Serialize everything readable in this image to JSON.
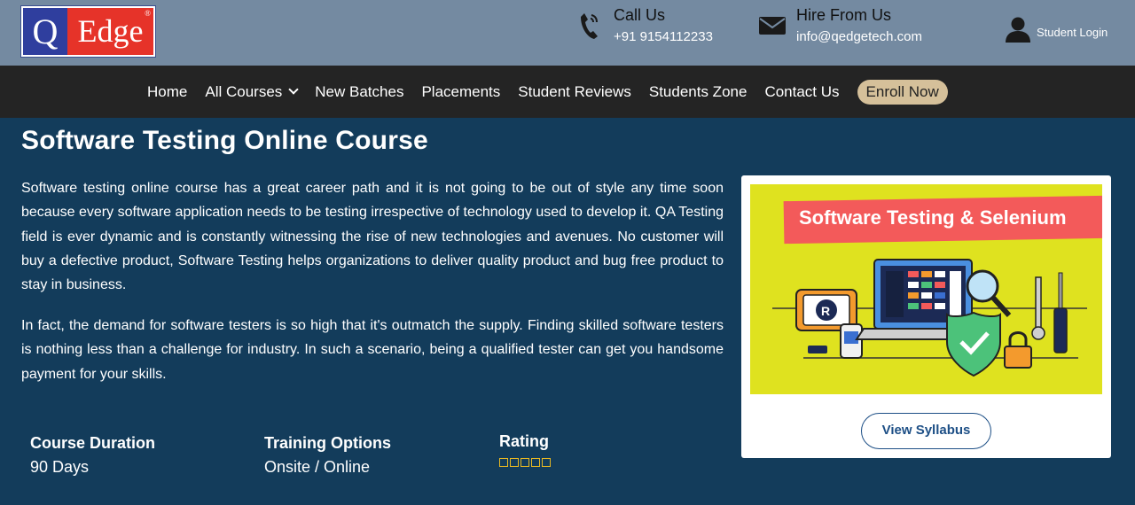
{
  "header": {
    "logo": {
      "left_letter": "Q",
      "right_text": "Edge",
      "reg_mark": "®"
    },
    "call": {
      "title": "Call Us",
      "number": "+91 9154112233",
      "icon": "phone-icon"
    },
    "hire": {
      "title": "Hire From Us",
      "email": "info@qedgetech.com",
      "icon": "envelope-icon"
    },
    "student_login": {
      "label": "Student Login",
      "icon": "user-icon"
    }
  },
  "nav": {
    "items": [
      "Home",
      "All Courses",
      "New Batches",
      "Placements",
      "Student Reviews",
      "Students Zone",
      "Contact Us"
    ],
    "dropdown_icon": "chevron-down-icon",
    "enroll": "Enroll Now"
  },
  "main": {
    "title": "Software Testing Online Course",
    "paragraphs": [
      "Software testing online course has a great career path and it is not going to be out of style any time soon because every software application needs to be testing irrespective of technology used to develop it. QA Testing field is ever dynamic and is constantly witnessing the rise of new technologies and avenues. No customer will buy a defective product, Software Testing helps organizations to deliver quality product and bug free product to stay in business.",
      "In fact, the demand for software testers is so high that it's outmatch the supply. Finding skilled software testers is nothing less than a challenge for industry. In such a scenario, being a qualified tester can get you handsome payment for your skills."
    ],
    "info": {
      "duration": {
        "label": "Course Duration",
        "value": "90 Days"
      },
      "training": {
        "label": "Training Options",
        "value": "Onsite / Online"
      },
      "rating": {
        "label": "Rating",
        "stars": 5
      }
    }
  },
  "card": {
    "banner_title": "Software Testing & Selenium",
    "button": "View Syllabus"
  },
  "colors": {
    "topbar": "#748aa1",
    "navbar": "#242424",
    "main_bg": "#133c5b",
    "enroll_bg": "#d5c09a",
    "banner_bg": "#dfe21f",
    "ribbon": "#f35a5a",
    "star": "#e8b923"
  }
}
